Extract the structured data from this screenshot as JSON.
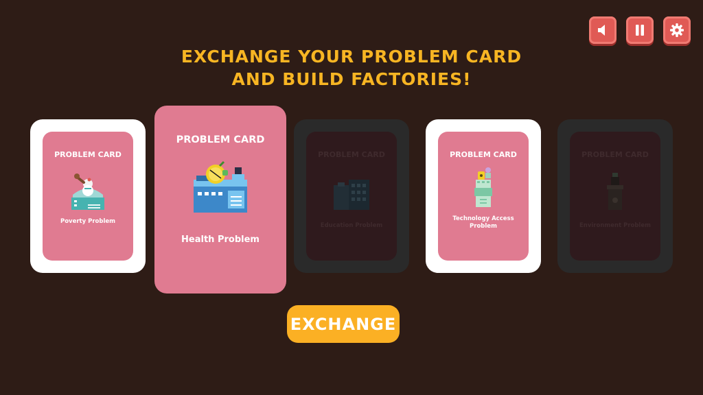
{
  "title": {
    "line1": "EXCHANGE YOUR PROBLEM CARD",
    "line2": "AND BUILD FACTORIES!"
  },
  "controls": {
    "icons": [
      "sound-icon",
      "pause-icon",
      "gear-icon"
    ],
    "accent": "#e05a55"
  },
  "cards": [
    {
      "header": "PROBLEM CARD",
      "name": "Poverty Problem",
      "state": "available"
    },
    {
      "header": "PROBLEM CARD",
      "name": "Health Problem",
      "state": "selected"
    },
    {
      "header": "PROBLEM CARD",
      "name": "Education Problem",
      "state": "locked"
    },
    {
      "header": "PROBLEM CARD",
      "name": "Technology Access Problem",
      "state": "available"
    },
    {
      "header": "PROBLEM CARD",
      "name": "Environment Problem",
      "state": "locked"
    }
  ],
  "exchange_button": {
    "label": "EXCHANGE",
    "color": "#fbb024"
  },
  "colors": {
    "background": "#2e1c16",
    "title": "#f7b523",
    "card_pink": "#e07b91"
  }
}
